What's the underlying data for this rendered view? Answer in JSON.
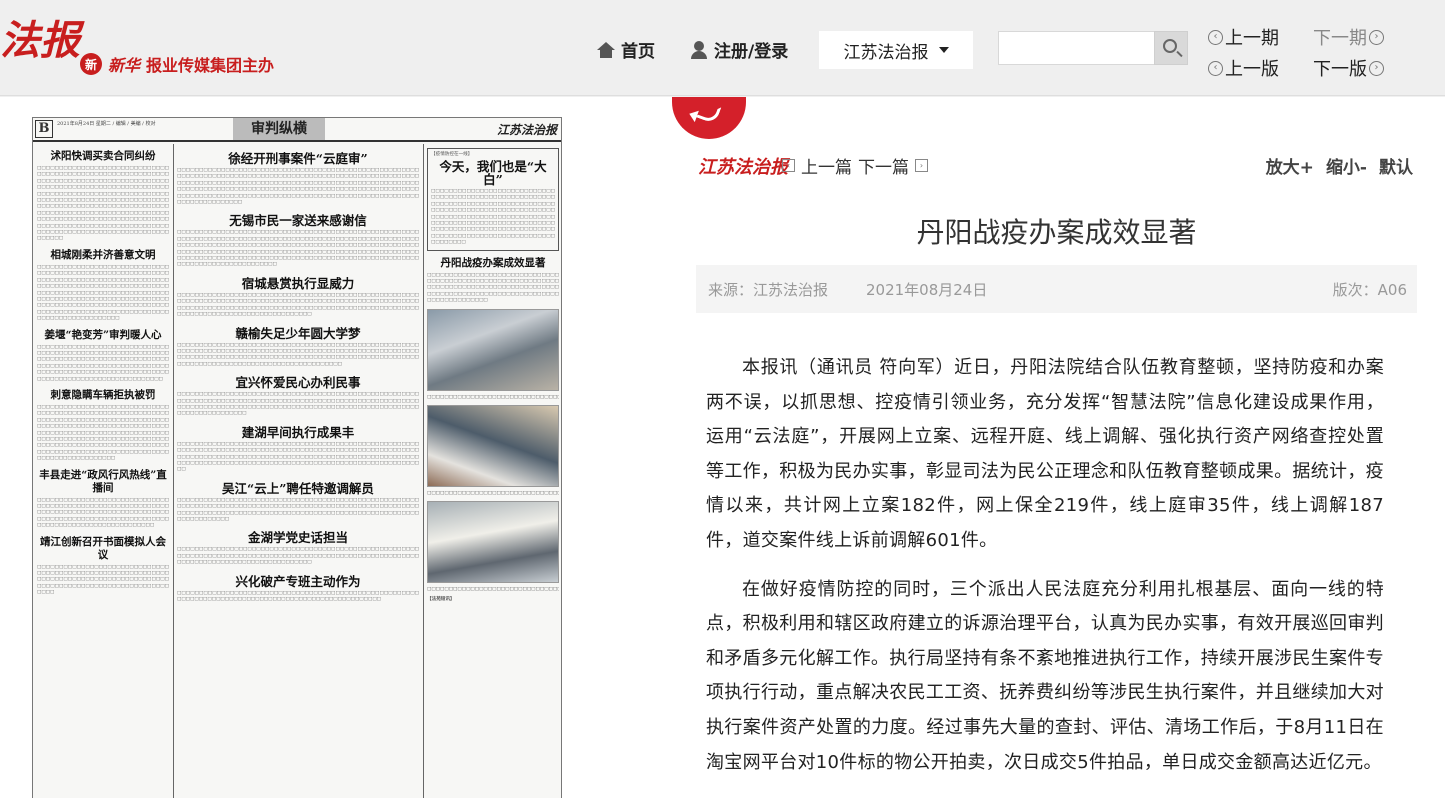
{
  "header": {
    "logo_text": "法报",
    "publisher_brand": "新华",
    "publisher_text": "报业传媒集团主办",
    "nav": {
      "home": "首页",
      "register_login": "注册/登录"
    },
    "paper_select": "江苏法治报",
    "search": {
      "placeholder": ""
    },
    "issue_nav": {
      "prev_issue": "上一期",
      "next_issue": "下一期",
      "prev_page": "上一版",
      "next_page": "下一版"
    }
  },
  "newspaper": {
    "page_letter": "B",
    "meta": "2021年8月24日 星期二 / 编辑 / 美编 / 校对",
    "section": "审判纵横",
    "masthead": "江苏法治报",
    "columns": [
      [
        "沭阳快调买卖合同纠纷",
        "相城刚柔并济善意文明",
        "姜堰“艳变芳”审判暖人心",
        "刺意隐瞒车辆拒执被罚",
        "丰县走进“政风行风热线”直播间",
        "靖江创新召开书面模拟人会议"
      ],
      [
        "徐经开刑事案件“云庭审”",
        "无锡市民一家送来感谢信",
        "宿城悬赏执行显威力",
        "赣榆失足少年圆大学梦",
        "宜兴怀爱民心办利民事",
        "建湖早间执行成果丰",
        "吴江“云上”聘任特邀调解员",
        "金湖学党史话担当",
        "兴化破产专班主动作为"
      ],
      [
        "【疫情防控在一线】",
        "今天，我们也是“大白”",
        "丹阳战疫办案成效显著",
        "【法苑短讯】"
      ]
    ]
  },
  "article": {
    "logo_text": "江苏法治报",
    "prev": "上一篇",
    "next": "下一篇",
    "zoom_in": "放大+",
    "zoom_out": "缩小-",
    "zoom_reset": "默认",
    "title": "丹阳战疫办案成效显著",
    "source": "来源：江苏法治报",
    "date": "2021年08月24日",
    "edition": "版次：A06",
    "paragraphs": [
      "本报讯（通讯员 符向军）近日，丹阳法院结合队伍教育整顿，坚持防疫和办案两不误，以抓思想、控疫情引领业务，充分发挥“智慧法院”信息化建设成果作用，运用“云法庭”，开展网上立案、远程开庭、线上调解、强化执行资产网络查控处置等工作，积极为民办实事，彰显司法为民公正理念和队伍教育整顿成果。据统计，疫情以来，共计网上立案182件，网上保全219件，线上庭审35件，线上调解187件，道交案件线上诉前调解601件。",
      "在做好疫情防控的同时，三个派出人民法庭充分利用扎根基层、面向一线的特点，积极利用和辖区政府建立的诉源治理平台，认真为民办实事，有效开展巡回审判和矛盾多元化解工作。执行局坚持有条不紊地推进执行工作，持续开展涉民生案件专项执行行动，重点解决农民工工资、抚养费纠纷等涉民生执行案件，并且继续加大对执行案件资产处置的力度。经过事先大量的查封、评估、清场工作后，于8月11日在淘宝网平台对10件标的物公开拍卖，次日成交5件拍品，单日成交金额高达近亿元。"
    ]
  }
}
